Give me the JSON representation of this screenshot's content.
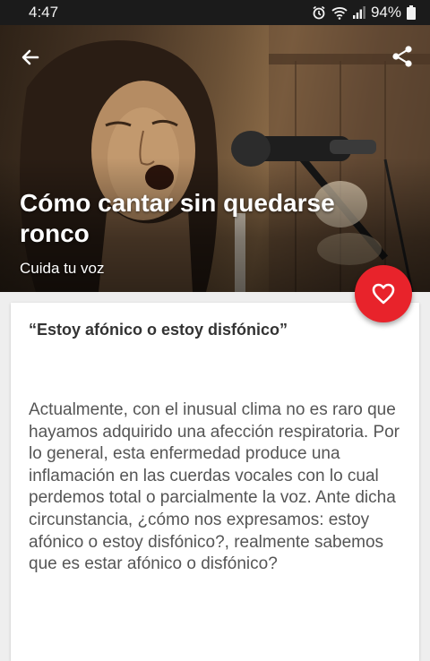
{
  "status_bar": {
    "time": "4:47",
    "battery_percent": "94%",
    "icons": [
      "alarm-icon",
      "wifi-icon",
      "signal-icon",
      "battery-icon"
    ]
  },
  "header": {
    "back_icon": "arrow-left-icon",
    "share_icon": "share-icon",
    "title": "Cómo cantar sin quedarse ronco",
    "subtitle": "Cuida tu voz",
    "favorite_icon": "heart-outline-icon"
  },
  "article": {
    "quote": "“Estoy afónico o estoy disfónico”",
    "body": "Actualmente, con el inusual clima no es raro que hayamos adquirido una afección respiratoria. Por lo general, esta enfermedad produce una inflamación en las cuerdas vocales con lo cual perdemos total o parcialmente la voz. Ante dicha circunstancia, ¿cómo nos expresamos: estoy afónico o estoy disfónico?, realmente sabemos que es estar afónico o disfónico?"
  },
  "colors": {
    "accent": "#e8232b",
    "status_bar": "#1b1b1b",
    "background": "#eeeeee",
    "card": "#ffffff",
    "body_text": "#555555",
    "quote_text": "#333333"
  }
}
